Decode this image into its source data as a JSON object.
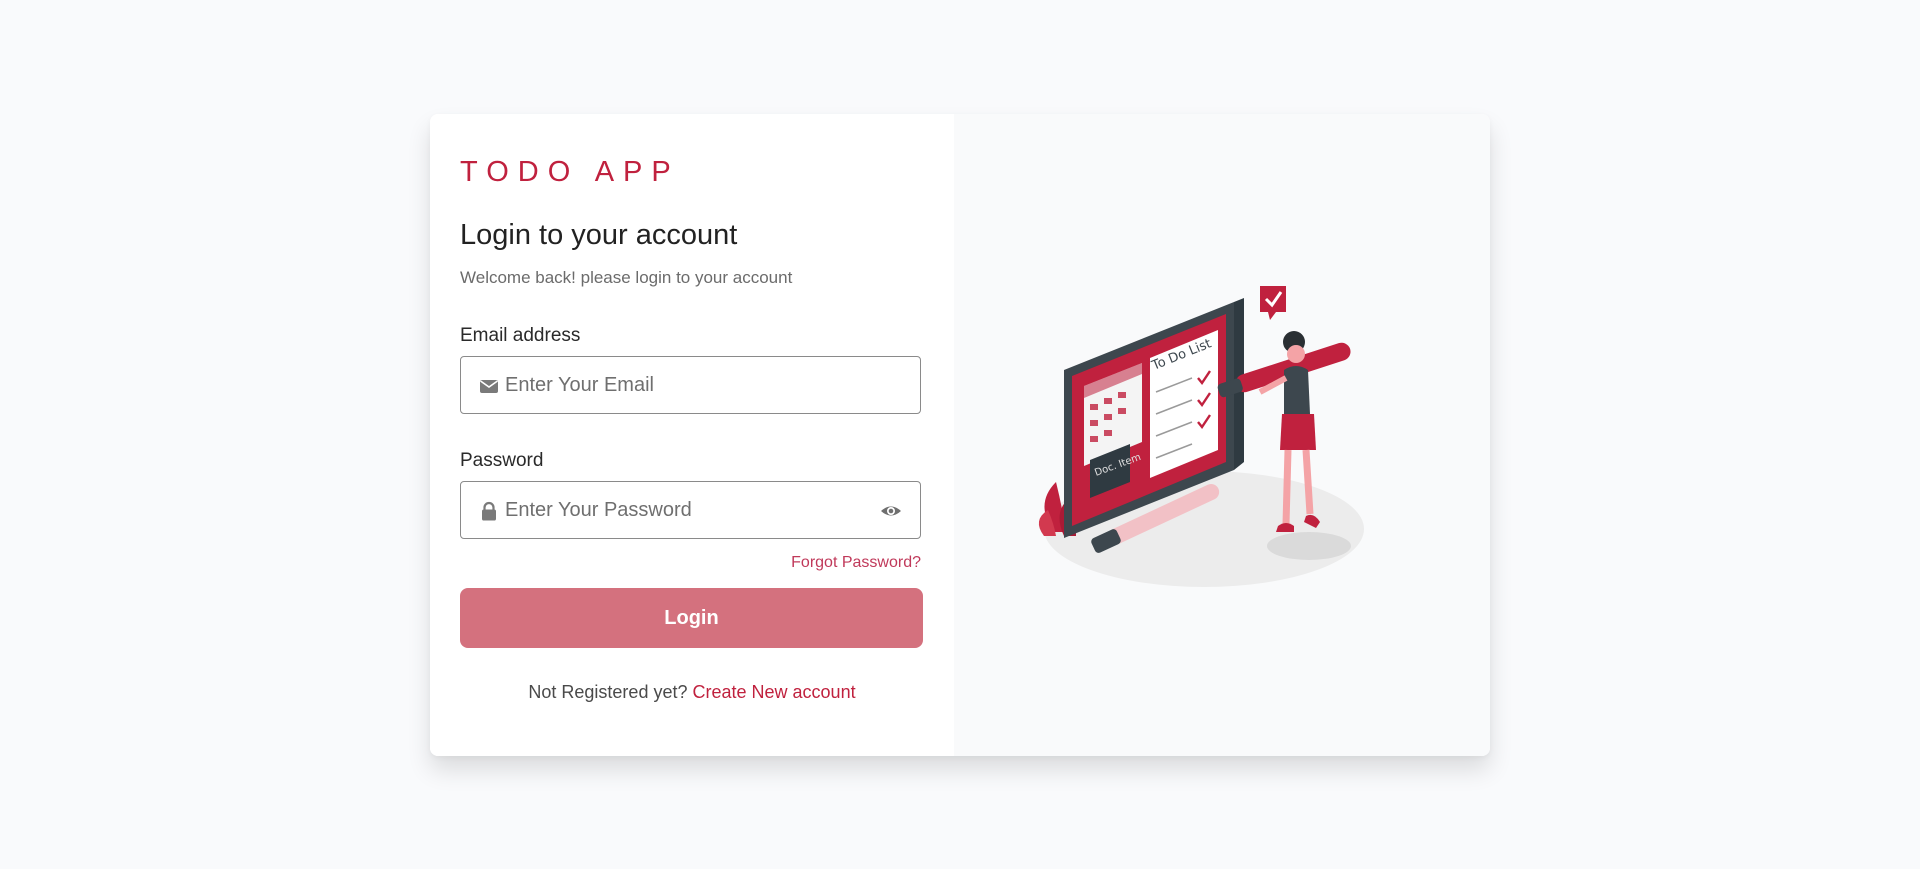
{
  "brand": "TODO APP",
  "heading": "Login to your account",
  "subtext": "Welcome back! please login to your account",
  "email": {
    "label": "Email address",
    "placeholder": "Enter Your Email",
    "icon": "envelope-icon"
  },
  "password": {
    "label": "Password",
    "placeholder": "Enter Your Password",
    "icon": "lock-icon",
    "toggle_icon": "eye-icon"
  },
  "forgot_label": "Forgot Password?",
  "login_label": "Login",
  "register": {
    "prompt": "Not Registered yet?",
    "link": "Create New account"
  },
  "illustration": {
    "board_title": "To Do List",
    "note_text": "Doc. Item"
  },
  "colors": {
    "brand": "#c0213e",
    "button": "#d4717e",
    "link": "#c0395a",
    "background": "#f9fafc"
  }
}
